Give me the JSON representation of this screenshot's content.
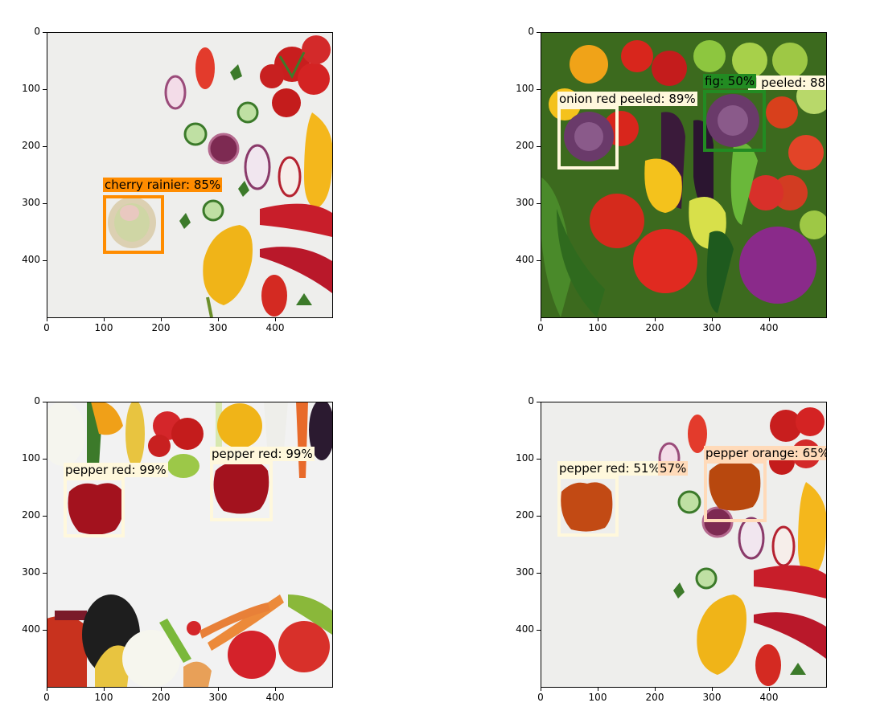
{
  "panels": [
    {
      "id": "top-left",
      "x_ticks": [
        "0",
        "100",
        "200",
        "300",
        "400"
      ],
      "y_ticks": [
        "0",
        "100",
        "200",
        "300",
        "400"
      ],
      "detections": [
        {
          "label": "cherry rainier: 85%",
          "color": "#ff8c00",
          "label_bg": "#ff8c00"
        }
      ]
    },
    {
      "id": "top-right",
      "x_ticks": [
        "0",
        "100",
        "200",
        "300",
        "400"
      ],
      "y_ticks": [
        "0",
        "100",
        "200",
        "300",
        "400"
      ],
      "detections": [
        {
          "label": "onion red peeled: 89%",
          "color": "#fff8dc",
          "label_bg": "#fff8dc"
        },
        {
          "label": "fig: 50%",
          "color": "#228b22",
          "label_bg": "#228b22"
        },
        {
          "label": "d peeled: 88",
          "color": "#fff8dc",
          "label_bg": "#fff8dc"
        }
      ]
    },
    {
      "id": "bottom-left",
      "x_ticks": [
        "0",
        "100",
        "200",
        "300",
        "400"
      ],
      "y_ticks": [
        "0",
        "100",
        "200",
        "300",
        "400"
      ],
      "detections": [
        {
          "label": "pepper red: 99%",
          "color": "#fff8dc",
          "label_bg": "#fff8dc"
        },
        {
          "label": "pepper red: 99%",
          "color": "#fff8dc",
          "label_bg": "#fff8dc"
        }
      ]
    },
    {
      "id": "bottom-right",
      "x_ticks": [
        "0",
        "100",
        "200",
        "300",
        "400"
      ],
      "y_ticks": [
        "0",
        "100",
        "200",
        "300",
        "400"
      ],
      "detections": [
        {
          "label": "pepper red: 51%",
          "color": "#fff8dc",
          "label_bg": "#fff8dc"
        },
        {
          "label": "57%",
          "color": "#ffdab9",
          "label_bg": "#ffdab9"
        },
        {
          "label": "pepper orange: 65%",
          "color": "#ffdab9",
          "label_bg": "#ffdab9"
        }
      ]
    }
  ]
}
